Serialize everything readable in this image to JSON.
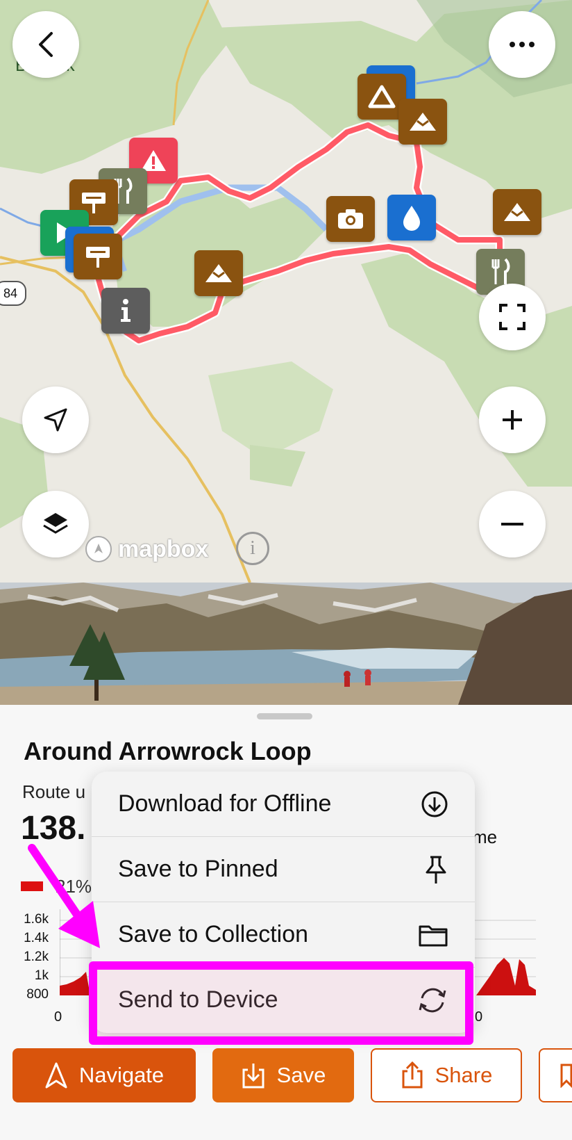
{
  "map": {
    "place_label": "B   Peak",
    "highway_number": "84",
    "attribution": "mapbox",
    "back_icon": "chevron-left-icon",
    "more_icon": "ellipsis-icon",
    "fullscreen_icon": "fullscreen-icon",
    "locate_icon": "location-arrow-icon",
    "layers_icon": "layers-icon",
    "zoom_in_icon": "plus-icon",
    "zoom_out_icon": "minus-icon",
    "route_color": "#ff5a66"
  },
  "route": {
    "title": "Around Arrowrock Loop",
    "subtitle_partial": "Route u",
    "distance_partial": "138.",
    "time_partial": "me",
    "legend_pct_partial": "21%"
  },
  "elevation": {
    "y_ticks": [
      "1.6k",
      "1.4k",
      "1.2k",
      "1k",
      "800"
    ],
    "x_tick_left": "0",
    "x_tick_right": "0",
    "fill_color": "#cc1010"
  },
  "menu": {
    "items": [
      {
        "label": "Download for Offline",
        "icon": "download-circle-icon"
      },
      {
        "label": "Save to Pinned",
        "icon": "pin-icon"
      },
      {
        "label": "Save to Collection",
        "icon": "folder-icon"
      },
      {
        "label": "Send to Device",
        "icon": "sync-icon"
      }
    ]
  },
  "actions": {
    "navigate": "Navigate",
    "save": "Save",
    "share": "Share"
  },
  "colors": {
    "accent": "#e05a0a",
    "highlight": "#ff00ff"
  }
}
